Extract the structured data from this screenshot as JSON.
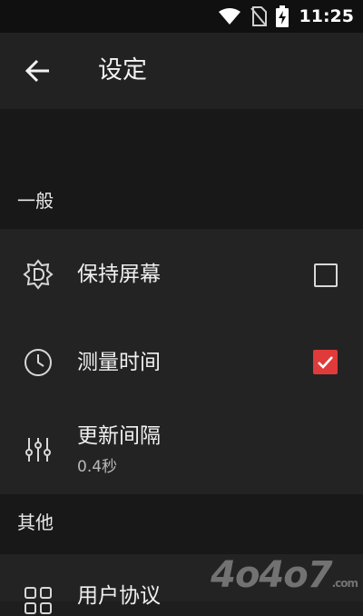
{
  "status_bar": {
    "time": "11:25",
    "icons": [
      "wifi-icon",
      "no-sim-icon",
      "battery-charging-icon"
    ]
  },
  "app_bar": {
    "back_icon": "arrow-left-icon",
    "title": "设定"
  },
  "sections": {
    "general": {
      "header": "一般",
      "items": {
        "keep_screen": {
          "icon": "screen-brightness-icon",
          "label": "保持屏幕",
          "checked": false
        },
        "measure_time": {
          "icon": "clock-icon",
          "label": "测量时间",
          "checked": true
        },
        "update_interval": {
          "icon": "sliders-icon",
          "label": "更新间隔",
          "value": "0.4秒"
        }
      }
    },
    "other": {
      "header": "其他",
      "items": {
        "user_agreement": {
          "icon": "grid-icon",
          "label": "用户协议"
        }
      }
    }
  },
  "colors": {
    "accent": "#e03a3a",
    "background": "#1e1e1e",
    "status_bar": "#101010"
  },
  "watermark": {
    "text": "4o4o7",
    "suffix": ".com"
  }
}
